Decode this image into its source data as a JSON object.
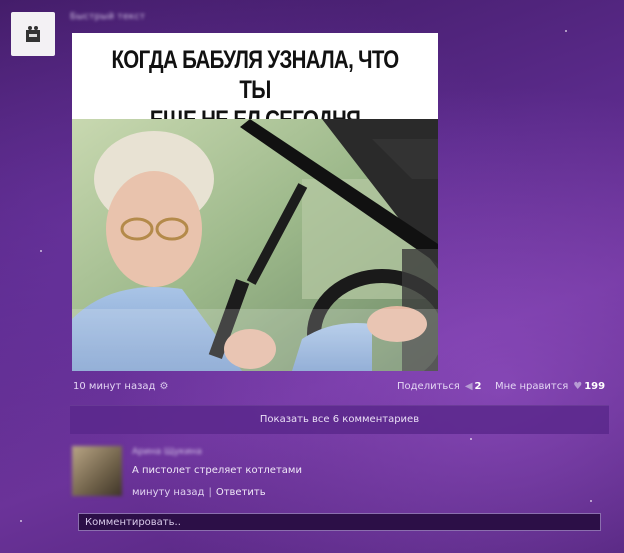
{
  "post": {
    "group_name": "Быстрый текст",
    "meme_caption_line1": "КОГДА БАБУЛЯ УЗНАЛА, ЧТО ТЫ",
    "meme_caption_line2": "ЕЩЕ НЕ ЕЛ СЕГОДНЯ",
    "time_label": "10 минут назад",
    "share_label": "Поделиться",
    "share_count": "2",
    "like_label": "Мне нравится",
    "like_count": "199"
  },
  "comments": {
    "show_all_label": "Показать все 6 комментариев",
    "items": [
      {
        "author": "Арина Щукина",
        "text": "А пистолет стреляет котлетами",
        "time": "минуту назад",
        "separator": "|",
        "reply_label": "Ответить"
      }
    ],
    "input_placeholder": "Комментировать.."
  },
  "colors": {
    "background": "#5a2a8a",
    "panel": "#5a288c",
    "input_bg": "#2c0f47"
  },
  "icons": {
    "gear": "gear-icon",
    "share": "megaphone-icon",
    "like": "heart-icon"
  }
}
